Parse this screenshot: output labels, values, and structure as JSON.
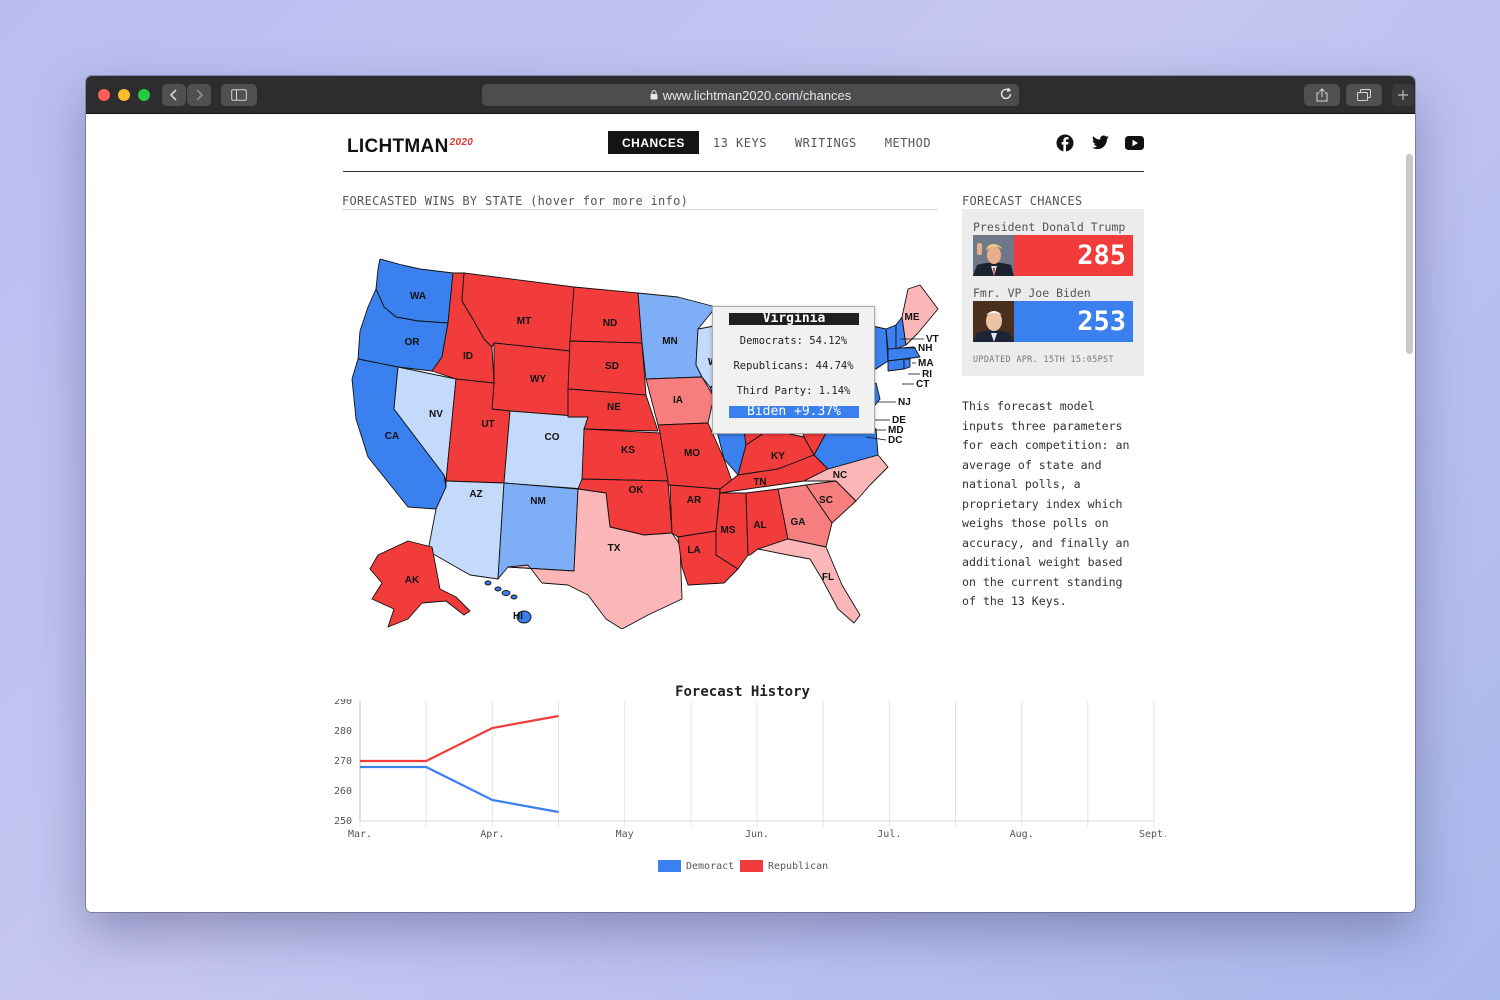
{
  "browser": {
    "url": "www.lichtman2020.com/chances"
  },
  "site": {
    "logo": "LICHTMAN",
    "logo_suffix": "2020",
    "nav": [
      {
        "label": "CHANCES",
        "active": true
      },
      {
        "label": "13 KEYS",
        "active": false
      },
      {
        "label": "WRITINGS",
        "active": false
      },
      {
        "label": "METHOD",
        "active": false
      }
    ],
    "social_icons": [
      "facebook-icon",
      "twitter-icon",
      "youtube-icon"
    ]
  },
  "map_section": {
    "label": "FORECASTED WINS BY STATE (hover for more info)"
  },
  "tooltip": {
    "state": "Virginia",
    "democrats": "Democrats: 54.12%",
    "republicans": "Republicans: 44.74%",
    "third_party": "Third Party: 1.14%",
    "margin": "Biden +9.37%",
    "margin_color": "#3a80ee"
  },
  "colors": {
    "safe_dem": "#3a80ee",
    "likely_dem": "#7eaef5",
    "lean_dem": "#c4dafa",
    "safe_rep": "#f23c3c",
    "likely_rep": "#f77e7e",
    "lean_rep": "#fbb7b7"
  },
  "forecast": {
    "label": "FORECAST CHANCES",
    "candidates": [
      {
        "name": "President Donald Trump",
        "votes": "285",
        "color": "#f23c3c"
      },
      {
        "name": "Fmr. VP Joe Biden",
        "votes": "253",
        "color": "#3a80ee"
      }
    ],
    "updated": "UPDATED APR. 15TH 15:05PST",
    "description": "This forecast model inputs three parameters for each competition: an average of state and national polls, a proprietary index which weighs those polls on accuracy, and finally an additional weight based on the current standing of the 13 Keys."
  },
  "chart_data": {
    "type": "line",
    "title": "Forecast History",
    "x_tick_labels": [
      "Mar.",
      "Apr.",
      "May",
      "Jun.",
      "Jul.",
      "Aug.",
      "Sept."
    ],
    "y_ticks": [
      250,
      260,
      270,
      280,
      290
    ],
    "ylim": [
      250,
      290
    ],
    "grid": true,
    "legend_position": "bottom",
    "x_points": [
      "Mar. 1",
      "Mar. 15",
      "Apr. 1",
      "Apr. 15"
    ],
    "series": [
      {
        "name": "Demoract",
        "color": "#3a80ee",
        "values": [
          268,
          268,
          257,
          253
        ]
      },
      {
        "name": "Republican",
        "color": "#f23c3c",
        "values": [
          270,
          270,
          281,
          285
        ]
      }
    ]
  }
}
